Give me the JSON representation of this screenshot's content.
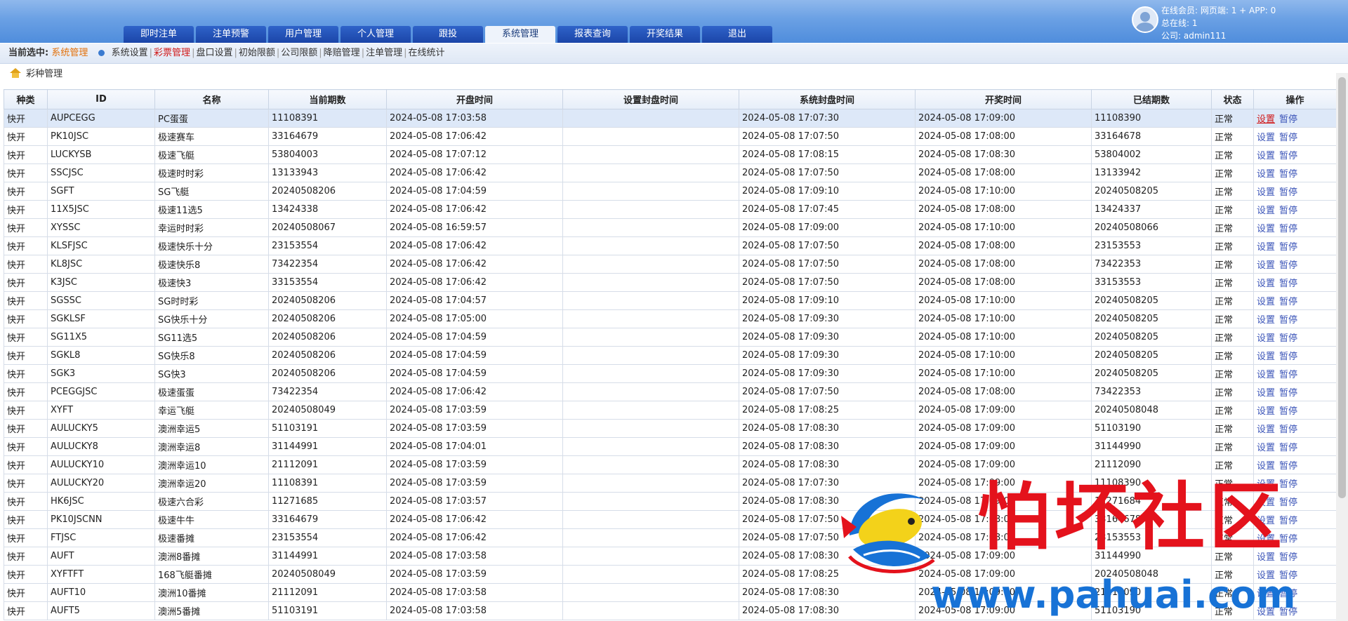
{
  "nav": {
    "tabs": [
      "即时注单",
      "注单预警",
      "用户管理",
      "个人管理",
      "跟投",
      "系统管理",
      "报表查询",
      "开奖结果",
      "退出"
    ],
    "active": "系统管理"
  },
  "user": {
    "line1": "在线会员:   网页端: 1 + APP: 0",
    "line2": "总在线: 1",
    "line3": "公司: admin111"
  },
  "subnav": {
    "label": "当前选中:",
    "current": "系统管理",
    "items": [
      "系统设置",
      "彩票管理",
      "盘口设置",
      "初始限额",
      "公司限额",
      "降赔管理",
      "注单管理",
      "在线统计"
    ],
    "selected_index": 1
  },
  "breadcrumb": "彩种管理",
  "table": {
    "headers": [
      "种类",
      "ID",
      "名称",
      "当前期数",
      "开盘时间",
      "设置封盘时间",
      "系统封盘时间",
      "开奖时间",
      "已结期数",
      "状态",
      "操作"
    ],
    "rows": [
      [
        "快开",
        "AUPCEGG",
        "PC蛋蛋",
        "11108391",
        "2024-05-08 17:03:58",
        "",
        "2024-05-08 17:07:30",
        "2024-05-08 17:09:00",
        "11108390",
        "正常"
      ],
      [
        "快开",
        "PK10JSC",
        "极速赛车",
        "33164679",
        "2024-05-08 17:06:42",
        "",
        "2024-05-08 17:07:50",
        "2024-05-08 17:08:00",
        "33164678",
        "正常"
      ],
      [
        "快开",
        "LUCKYSB",
        "极速飞艇",
        "53804003",
        "2024-05-08 17:07:12",
        "",
        "2024-05-08 17:08:15",
        "2024-05-08 17:08:30",
        "53804002",
        "正常"
      ],
      [
        "快开",
        "SSCJSC",
        "极速时时彩",
        "13133943",
        "2024-05-08 17:06:42",
        "",
        "2024-05-08 17:07:50",
        "2024-05-08 17:08:00",
        "13133942",
        "正常"
      ],
      [
        "快开",
        "SGFT",
        "SG飞艇",
        "20240508206",
        "2024-05-08 17:04:59",
        "",
        "2024-05-08 17:09:10",
        "2024-05-08 17:10:00",
        "20240508205",
        "正常"
      ],
      [
        "快开",
        "11X5JSC",
        "极速11选5",
        "13424338",
        "2024-05-08 17:06:42",
        "",
        "2024-05-08 17:07:45",
        "2024-05-08 17:08:00",
        "13424337",
        "正常"
      ],
      [
        "快开",
        "XYSSC",
        "幸运时时彩",
        "20240508067",
        "2024-05-08 16:59:57",
        "",
        "2024-05-08 17:09:00",
        "2024-05-08 17:10:00",
        "20240508066",
        "正常"
      ],
      [
        "快开",
        "KLSFJSC",
        "极速快乐十分",
        "23153554",
        "2024-05-08 17:06:42",
        "",
        "2024-05-08 17:07:50",
        "2024-05-08 17:08:00",
        "23153553",
        "正常"
      ],
      [
        "快开",
        "KL8JSC",
        "极速快乐8",
        "73422354",
        "2024-05-08 17:06:42",
        "",
        "2024-05-08 17:07:50",
        "2024-05-08 17:08:00",
        "73422353",
        "正常"
      ],
      [
        "快开",
        "K3JSC",
        "极速快3",
        "33153554",
        "2024-05-08 17:06:42",
        "",
        "2024-05-08 17:07:50",
        "2024-05-08 17:08:00",
        "33153553",
        "正常"
      ],
      [
        "快开",
        "SGSSC",
        "SG时时彩",
        "20240508206",
        "2024-05-08 17:04:57",
        "",
        "2024-05-08 17:09:10",
        "2024-05-08 17:10:00",
        "20240508205",
        "正常"
      ],
      [
        "快开",
        "SGKLSF",
        "SG快乐十分",
        "20240508206",
        "2024-05-08 17:05:00",
        "",
        "2024-05-08 17:09:30",
        "2024-05-08 17:10:00",
        "20240508205",
        "正常"
      ],
      [
        "快开",
        "SG11X5",
        "SG11选5",
        "20240508206",
        "2024-05-08 17:04:59",
        "",
        "2024-05-08 17:09:30",
        "2024-05-08 17:10:00",
        "20240508205",
        "正常"
      ],
      [
        "快开",
        "SGKL8",
        "SG快乐8",
        "20240508206",
        "2024-05-08 17:04:59",
        "",
        "2024-05-08 17:09:30",
        "2024-05-08 17:10:00",
        "20240508205",
        "正常"
      ],
      [
        "快开",
        "SGK3",
        "SG快3",
        "20240508206",
        "2024-05-08 17:04:59",
        "",
        "2024-05-08 17:09:30",
        "2024-05-08 17:10:00",
        "20240508205",
        "正常"
      ],
      [
        "快开",
        "PCEGGJSC",
        "极速蛋蛋",
        "73422354",
        "2024-05-08 17:06:42",
        "",
        "2024-05-08 17:07:50",
        "2024-05-08 17:08:00",
        "73422353",
        "正常"
      ],
      [
        "快开",
        "XYFT",
        "幸运飞艇",
        "20240508049",
        "2024-05-08 17:03:59",
        "",
        "2024-05-08 17:08:25",
        "2024-05-08 17:09:00",
        "20240508048",
        "正常"
      ],
      [
        "快开",
        "AULUCKY5",
        "澳洲幸运5",
        "51103191",
        "2024-05-08 17:03:59",
        "",
        "2024-05-08 17:08:30",
        "2024-05-08 17:09:00",
        "51103190",
        "正常"
      ],
      [
        "快开",
        "AULUCKY8",
        "澳洲幸运8",
        "31144991",
        "2024-05-08 17:04:01",
        "",
        "2024-05-08 17:08:30",
        "2024-05-08 17:09:00",
        "31144990",
        "正常"
      ],
      [
        "快开",
        "AULUCKY10",
        "澳洲幸运10",
        "21112091",
        "2024-05-08 17:03:59",
        "",
        "2024-05-08 17:08:30",
        "2024-05-08 17:09:00",
        "21112090",
        "正常"
      ],
      [
        "快开",
        "AULUCKY20",
        "澳洲幸运20",
        "11108391",
        "2024-05-08 17:03:59",
        "",
        "2024-05-08 17:07:30",
        "2024-05-08 17:09:00",
        "11108390",
        "正常"
      ],
      [
        "快开",
        "HK6JSC",
        "极速六合彩",
        "11271685",
        "2024-05-08 17:03:57",
        "",
        "2024-05-08 17:08:30",
        "2024-05-08 17:09:00",
        "11271684",
        "正常"
      ],
      [
        "快开",
        "PK10JSCNN",
        "极速牛牛",
        "33164679",
        "2024-05-08 17:06:42",
        "",
        "2024-05-08 17:07:50",
        "2024-05-08 17:08:00",
        "33164678",
        "正常"
      ],
      [
        "快开",
        "FTJSC",
        "极速番摊",
        "23153554",
        "2024-05-08 17:06:42",
        "",
        "2024-05-08 17:07:50",
        "2024-05-08 17:08:00",
        "23153553",
        "正常"
      ],
      [
        "快开",
        "AUFT",
        "澳洲8番摊",
        "31144991",
        "2024-05-08 17:03:58",
        "",
        "2024-05-08 17:08:30",
        "2024-05-08 17:09:00",
        "31144990",
        "正常"
      ],
      [
        "快开",
        "XYFTFT",
        "168飞艇番摊",
        "20240508049",
        "2024-05-08 17:03:59",
        "",
        "2024-05-08 17:08:25",
        "2024-05-08 17:09:00",
        "20240508048",
        "正常"
      ],
      [
        "快开",
        "AUFT10",
        "澳洲10番摊",
        "21112091",
        "2024-05-08 17:03:58",
        "",
        "2024-05-08 17:08:30",
        "2024-05-08 17:09:00",
        "21112090",
        "正常"
      ],
      [
        "快开",
        "AUFT5",
        "澳洲5番摊",
        "51103191",
        "2024-05-08 17:03:58",
        "",
        "2024-05-08 17:08:30",
        "2024-05-08 17:09:00",
        "51103190",
        "正常"
      ]
    ],
    "actions": [
      "设置",
      "暂停"
    ],
    "selected_row": 0
  },
  "watermark": {
    "text": "怕坏社区",
    "url": "www.pahuai.com"
  },
  "colors": {
    "header_bg": "#6aa0e4",
    "tab_bg": "#1b45a8",
    "highlight_red": "#d01818",
    "current_orange": "#e2700a",
    "link_blue": "#3b54b8",
    "watermark_red": "#e4121c",
    "watermark_blue": "#1772d6"
  }
}
